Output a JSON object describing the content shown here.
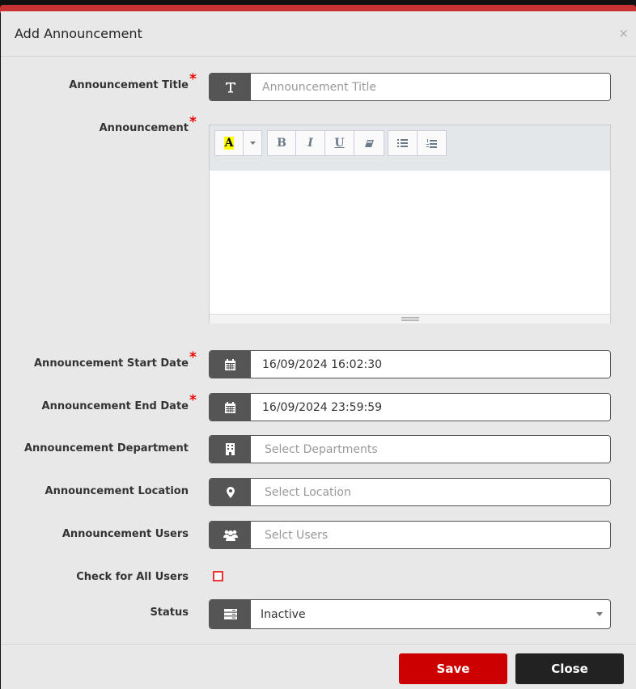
{
  "dialog": {
    "title": "Add Announcement",
    "close_symbol": "×"
  },
  "form": {
    "title_label": "Announcement Title",
    "title_placeholder": "Announcement Title",
    "announcement_label": "Announcement",
    "start_label": "Announcement Start Date",
    "start_value": "16/09/2024 16:02:30",
    "end_label": "Announcement End Date",
    "end_value": "16/09/2024 23:59:59",
    "dept_label": "Announcement Department",
    "dept_placeholder": "Select Departments",
    "location_label": "Announcement Location",
    "location_placeholder": "Select Location",
    "users_label": "Announcement Users",
    "users_placeholder": "Selct Users",
    "all_users_label": "Check for All Users",
    "all_users_checked": false,
    "status_label": "Status",
    "status_value": "Inactive",
    "required_mark": "*"
  },
  "toolbar": {
    "color_glyph": "A",
    "bold": "B",
    "italic": "I",
    "underline": "U"
  },
  "buttons": {
    "save": "Save",
    "close": "Close"
  },
  "colors": {
    "accent": "#cc0000",
    "header_band": "#c93232",
    "addon": "#555555",
    "close_button": "#222222"
  }
}
